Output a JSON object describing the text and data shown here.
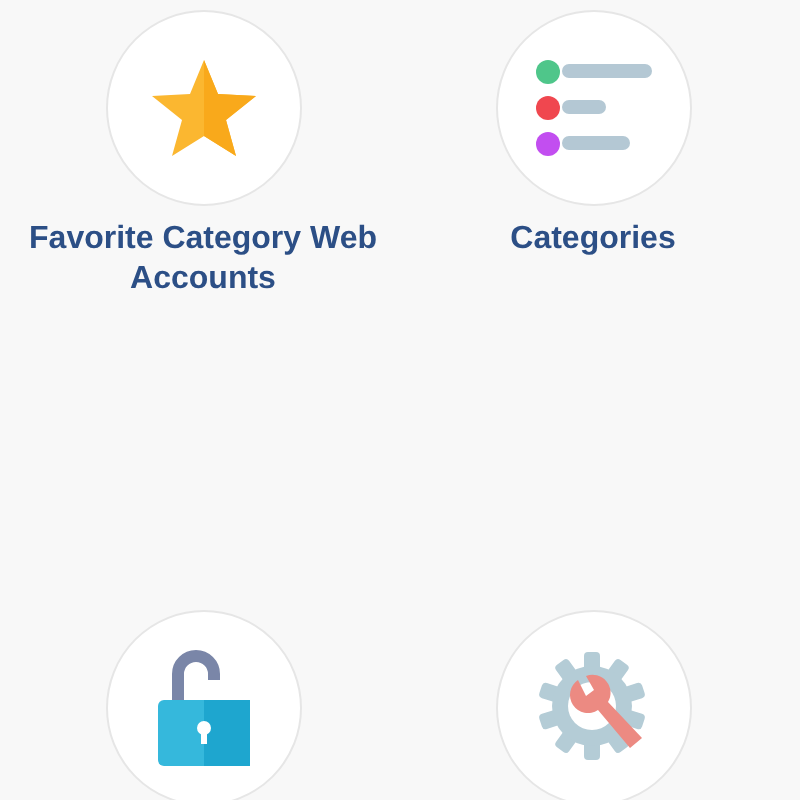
{
  "tiles": [
    {
      "kind": "star",
      "label": "Favorite Category Web Accounts"
    },
    {
      "kind": "list",
      "label": "Categories"
    },
    {
      "kind": "lock"
    },
    {
      "kind": "tools"
    }
  ]
}
